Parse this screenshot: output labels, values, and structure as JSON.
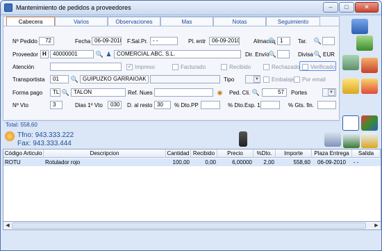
{
  "window": {
    "title": "Mantenimiento de pedidos a proveedores"
  },
  "tabs": [
    "Cabecera",
    "Varios",
    "Observaciones",
    "Mas",
    "Notas",
    "Seguimiento"
  ],
  "form": {
    "n_pedido_label": "Nº Pedido",
    "n_pedido": "72",
    "fecha_label": "Fecha",
    "fecha": "06-09-2010",
    "fsalpr_label": "F.Sal.Pr.",
    "fsalpr": "- -",
    "pl_entr_label": "Pl. entr",
    "pl_entr": "06-09-2010",
    "almacen_label": "Almacén",
    "almacen": "1",
    "tar_label": "Tar.",
    "proveedor_label": "Proveedor",
    "proveedor_h": "H",
    "proveedor_code": "40000001",
    "proveedor_name": "COMERCIAL ABC, S.L.",
    "dir_envio_label": "Dir. Envío",
    "divisa_label": "Divisa",
    "divisa": "EUR",
    "atencion_label": "Atención",
    "impreso_label": "Impreso",
    "facturado_label": "Facturado",
    "recibido_label": "Recibido",
    "rechazado_label": "Rechazado",
    "verificado_label": "Verificado",
    "transportista_label": "Transportista",
    "transportista_code": "01",
    "transportista_name": "GUIPUZKO GARRAIOAK",
    "tipo_label": "Tipo",
    "embalajes_label": "Embalajes",
    "por_email_label": "Por email",
    "forma_pago_label": "Forma pago",
    "forma_pago_code": "TL",
    "forma_pago_name": "TALON",
    "ref_nues_label": "Ref. Nues",
    "ped_cli_label": "Ped. Cli.",
    "ped_cli": "57",
    "portes_label": "Portes",
    "n_vto_label": "Nº Vto",
    "n_vto": "3",
    "dias_vto_label": "Dias 1º Vto",
    "dias_vto": "030",
    "d_resto_label": "D. al resto",
    "d_resto": "30",
    "dto_pp_label": "% Dto.PP",
    "dto_esp_label": "% Dto.Esp. 1",
    "gts_fin_label": "% Gts. fin."
  },
  "total": "Total: 558,60",
  "contact": {
    "tfno": "Tfno: 943.333.222",
    "fax": "Fax: 943.333.444"
  },
  "table": {
    "headers": [
      "Código Articulo",
      "Descripcion",
      "Cantidad",
      "Recibido",
      "Precio",
      "%Dto.",
      "Importe",
      "Plaza Entrega",
      "Salida"
    ],
    "rows": [
      [
        "ROTU",
        "Rotulador rojo",
        "100,00",
        "0,00",
        "6,00000",
        "2,00",
        "558,60",
        "06-09-2010",
        "- -"
      ]
    ]
  },
  "colors": {
    "accent": "#1f4f9a",
    "selected_row": "#d9e7fb",
    "tab_active_border": "#d5844e"
  }
}
